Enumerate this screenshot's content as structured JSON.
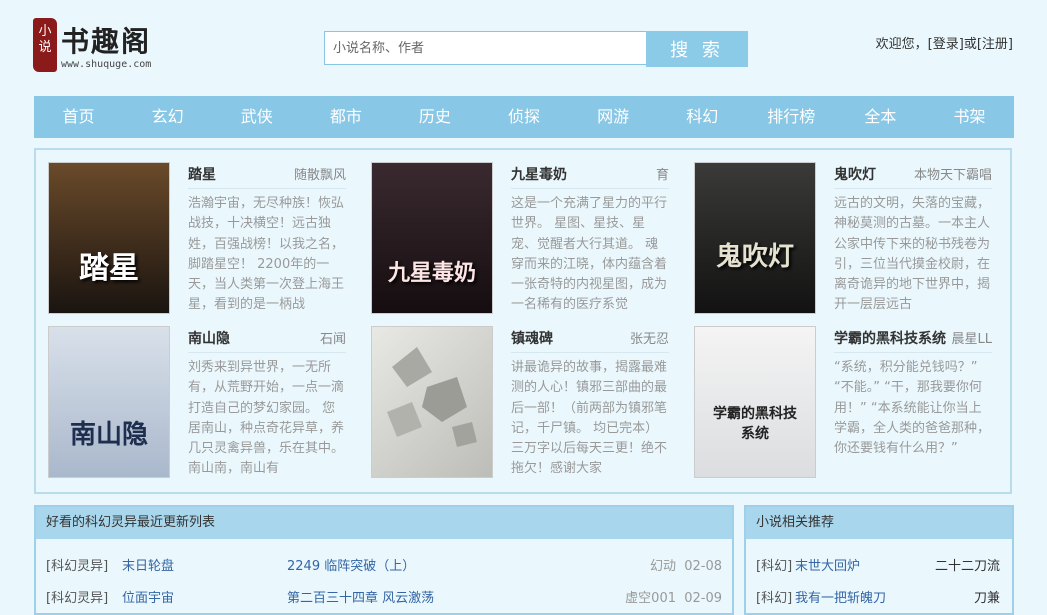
{
  "header": {
    "logo_seal": "小说",
    "logo_title": "书趣阁",
    "logo_url": "www.shuquge.com",
    "search_placeholder": "小说名称、作者",
    "search_button": "搜 索",
    "welcome": "欢迎您，",
    "login": "[登录]",
    "or": "或",
    "register": "[注册]"
  },
  "nav": [
    "首页",
    "玄幻",
    "武侠",
    "都市",
    "历史",
    "侦探",
    "网游",
    "科幻",
    "排行榜",
    "全本",
    "书架"
  ],
  "featured": [
    {
      "title": "踏星",
      "author": "随散飘风",
      "cover_text": "踏星",
      "cover_color": "#3a2a1a",
      "desc": "浩瀚宇宙，无尽种族！恢弘战技，十决横空！远古独姓，百强战榜！以我之名，脚踏星空！ 2200年的一天，当人类第一次登上海王星，看到的是一柄战"
    },
    {
      "title": "九星毒奶",
      "author": "育",
      "cover_text": "九星毒奶",
      "cover_color": "#2a1a1e",
      "desc": "这是一个充满了星力的平行世界。 星图、星技、星宠、觉醒者大行其道。 魂穿而来的江晓，体内蕴含着一张奇特的内视星图，成为一名稀有的医疗系觉"
    },
    {
      "title": "鬼吹灯",
      "author": "本物天下霸唱",
      "cover_text": "鬼吹灯",
      "cover_color": "#1e1e1e",
      "desc": "远古的文明，失落的宝藏，神秘莫测的古墓。一本主人公家中传下来的秘书残卷为引，三位当代摸金校尉，在离奇诡异的地下世界中，揭开一层层远古"
    },
    {
      "title": "南山隐",
      "author": "石闻",
      "cover_text": "南山隐",
      "cover_color": "#b8c8dc",
      "desc": "刘秀来到异世界，一无所有，从荒野开始，一点一滴打造自己的梦幻家园。 您居南山，种点奇花异草，养几只灵禽异兽，乐在其中。南山南，南山有"
    },
    {
      "title": "镇魂碑",
      "author": "张无忍",
      "cover_text": "",
      "cover_color": "#d6d6d2",
      "desc": "讲最诡异的故事，揭露最难测的人心！镇邪三部曲的最后一部！（前两部为镇邪笔记，千尸镇。 均已完本）三万字以后每天三更！绝不拖欠！感谢大家"
    },
    {
      "title": "学霸的黑科技系统",
      "author": "晨星LL",
      "cover_text": "学霸的黑科技系统",
      "cover_color": "#ecedee",
      "desc": "“系统，积分能兑钱吗？” “不能。” “干，那我要你何用！” “本系统能让你当上学霸，全人类的爸爸那种，你还要钱有什么用？”"
    }
  ],
  "latest": {
    "heading": "好看的科幻灵异最近更新列表",
    "rows": [
      {
        "cat": "[科幻灵异]",
        "book": "末日轮盘",
        "chapter": "2249 临阵突破（上）",
        "author": "幻动",
        "date": "02-08"
      },
      {
        "cat": "[科幻灵异]",
        "book": "位面宇宙",
        "chapter": "第二百三十四章 风云激荡",
        "author": "虚空001",
        "date": "02-09"
      }
    ]
  },
  "related": {
    "heading": "小说相关推荐",
    "rows": [
      {
        "cat": "[科幻]",
        "book": "末世大回炉",
        "author": "二十二刀流"
      },
      {
        "cat": "[科幻]",
        "book": "我有一把斩魄刀",
        "author": "刀兼"
      }
    ]
  }
}
